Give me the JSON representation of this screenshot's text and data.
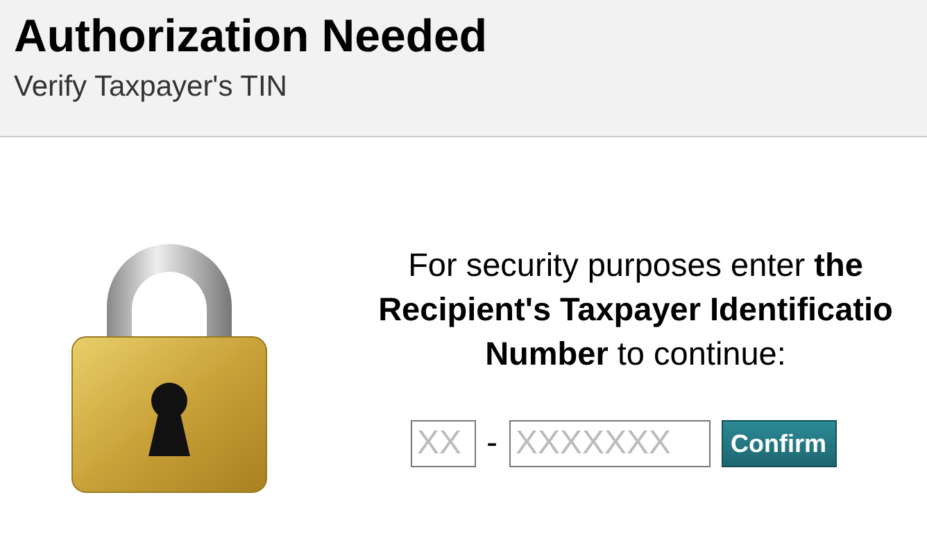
{
  "header": {
    "title": "Authorization Needed",
    "subtitle": "Verify Taxpayer's TIN"
  },
  "prompt": "For security purposes enter **the Recipient's Taxpayer Identificatio Number** to continue:",
  "fields": [
    {
      "placeholder": "XX"
    },
    {
      "placeholder": "XXXXXXX"
    }
  ],
  "separator": "-",
  "button": "Confirm"
}
